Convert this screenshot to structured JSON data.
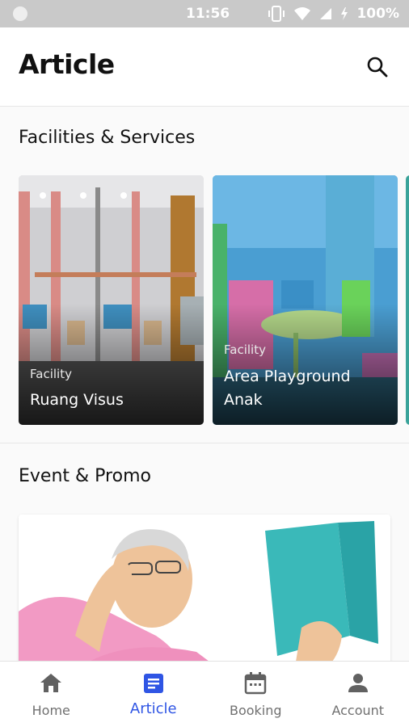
{
  "status_bar": {
    "time": "11:56",
    "battery": "100%"
  },
  "app_bar": {
    "title": "Article"
  },
  "sections": {
    "facilities": {
      "title": "Facilities & Services",
      "cards": [
        {
          "category": "Facility",
          "title": "Ruang Visus"
        },
        {
          "category": "Facility",
          "title": "Area Playground Anak"
        }
      ]
    },
    "events": {
      "title": "Event & Promo"
    }
  },
  "bottom_nav": {
    "items": [
      {
        "label": "Home",
        "icon": "home-icon"
      },
      {
        "label": "Article",
        "icon": "article-icon",
        "active": true
      },
      {
        "label": "Booking",
        "icon": "calendar-icon"
      },
      {
        "label": "Account",
        "icon": "person-icon"
      }
    ]
  },
  "colors": {
    "accent": "#2f55e4",
    "inactive": "#707070",
    "status_bar": "#c9c9c9"
  }
}
